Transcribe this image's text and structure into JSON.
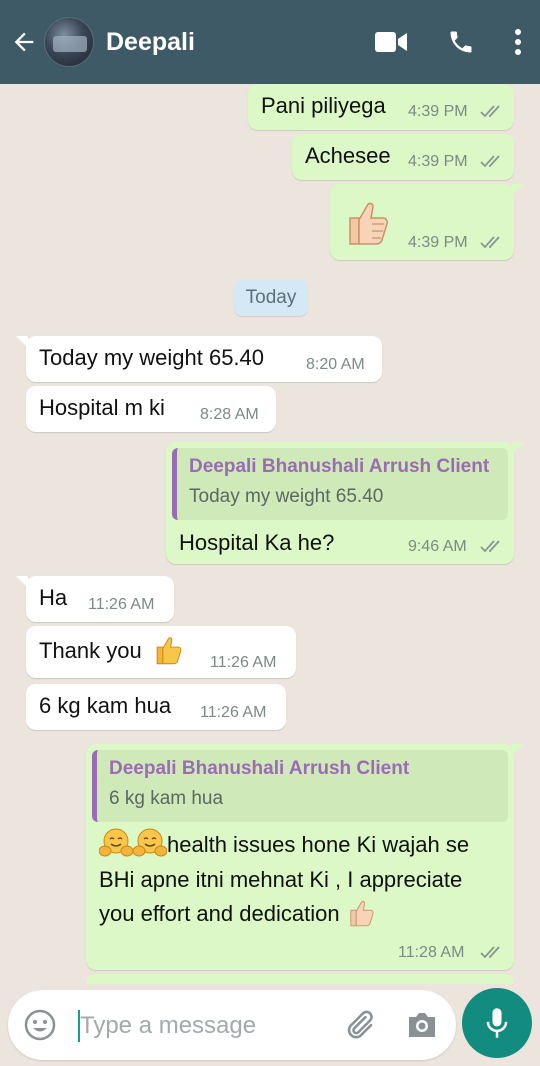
{
  "header": {
    "contact_name": "Deepali"
  },
  "day_chip": "Today",
  "messages": [
    {
      "text": "Pani piliyega",
      "time": "4:39 PM"
    },
    {
      "text": "Achesee",
      "time": "4:39 PM"
    },
    {
      "text": "",
      "time": "4:39 PM"
    },
    {
      "text": "Today my weight 65.40",
      "time": "8:20 AM"
    },
    {
      "text": "Hospital m ki",
      "time": "8:28 AM"
    },
    {
      "quote_name": "Deepali Bhanushali Arrush Client",
      "quote_text": "Today my weight 65.40",
      "text": "Hospital Ka he?",
      "time": "9:46 AM"
    },
    {
      "text": "Ha",
      "time": "11:26 AM"
    },
    {
      "text": "Thank you",
      "time": "11:26 AM"
    },
    {
      "text": "6 kg kam hua",
      "time": "11:26 AM"
    },
    {
      "quote_name": "Deepali Bhanushali Arrush Client",
      "quote_text": "6 kg kam hua",
      "line1": "health issues hone Ki wajah se",
      "line2": "BHi apne itni mehnat Ki , I appreciate",
      "line3": "you effort and dedication",
      "time": "11:28 AM"
    }
  ],
  "composer": {
    "placeholder": "Type a message"
  },
  "colors": {
    "header": "#3d5a66",
    "outgoing_bubble": "#dcf8c6",
    "incoming_bubble": "#ffffff",
    "quote_accent": "#9c6bb6",
    "send_button": "#128c7e"
  },
  "icons": [
    "back-arrow-icon",
    "video-call-icon",
    "phone-icon",
    "more-icon",
    "emoji-icon",
    "attach-icon",
    "camera-icon",
    "mic-icon",
    "double-tick-icon",
    "thumbs-up-icon",
    "hugging-face-icon"
  ]
}
